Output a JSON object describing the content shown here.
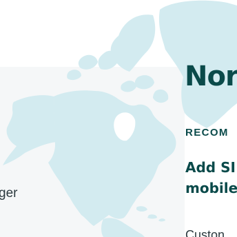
{
  "colors": {
    "background": "#ffffff",
    "panel": "#f5f7f8",
    "map_land": "#d3ebf0",
    "heading": "#0a4a4a",
    "body_text": "#2c3a3f"
  },
  "left_panel": {
    "partial_text": "ger"
  },
  "region": {
    "title": "Nor"
  },
  "recommendation": {
    "eyebrow": "RECOM",
    "title_line1": "Add SI",
    "title_line2": "mobile",
    "subtext": "Custon"
  }
}
